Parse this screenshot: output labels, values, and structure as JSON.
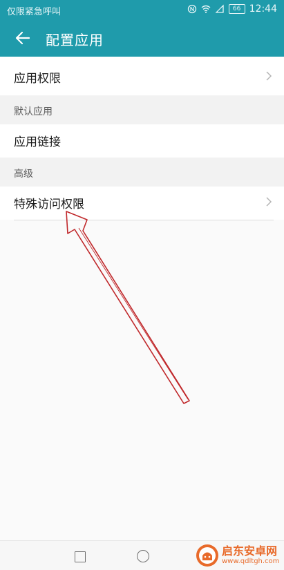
{
  "status_bar": {
    "carrier": "仅限紧急呼叫",
    "battery": "66",
    "time": "12:44"
  },
  "header": {
    "title": "配置应用"
  },
  "list": {
    "app_permissions": "应用权限",
    "default_apps_section": "默认应用",
    "app_links": "应用链接",
    "advanced_section": "高级",
    "special_access": "特殊访问权限"
  },
  "watermark": {
    "title": "启东安卓网",
    "url": "www.qdltgh.com"
  },
  "colors": {
    "header_bg": "#1f9bab",
    "annotation_arrow": "#c0282b",
    "watermark": "#e86a2a"
  }
}
